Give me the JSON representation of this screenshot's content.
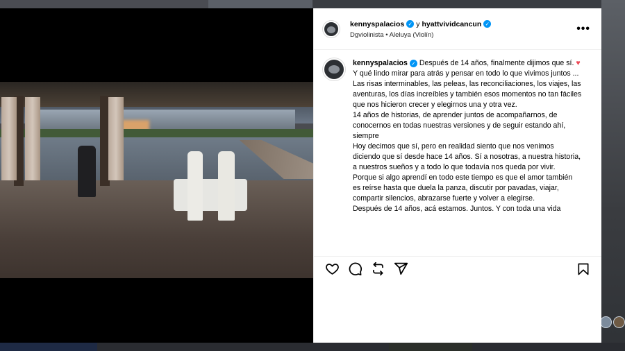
{
  "post": {
    "author": "kennyspalacios",
    "connector": "y",
    "collaborator": "hyattvividcancun",
    "audio_line": "Dgviolinista • Aleluya (Violín)",
    "more_label": "•••"
  },
  "caption": {
    "author": "kennyspalacios",
    "first_line": "Después de 14 años, finalmente dijimos que sí.",
    "heart": "♥",
    "paragraphs": [
      "Y qué lindo mirar para atrás y pensar en todo lo que vivimos juntos ... Las risas interminables, las peleas, las reconciliaciones, los viajes, las aventuras, los días increíbles y también esos momentos no tan fáciles que nos hicieron crecer y elegirnos una y otra vez.",
      "14 años de historias, de aprender juntos de acompañarnos, de conocernos en todas nuestras versiones y de seguir estando ahí, siempre",
      "Hoy decimos que sí, pero en realidad siento que nos venimos diciendo que sí desde hace 14 años. Sí a nosotras, a nuestra historia, a nuestros sueños y a todo lo que todavía nos queda por vivir.",
      "Porque si algo aprendí en todo este tiempo es que el amor también es reírse hasta que duela la panza, discutir por pavadas, viajar, compartir silencios, abrazarse fuerte y volver a elegirse.",
      "Después de 14 años, acá estamos. Juntos. Y con toda una vida"
    ]
  },
  "icons": {
    "verified": "verified-badge-icon",
    "mute": "speaker-muted-icon",
    "like": "heart-outline-icon",
    "comment": "comment-icon",
    "repost": "repost-icon",
    "share": "send-paper-plane-icon",
    "save": "bookmark-icon"
  },
  "colors": {
    "verified_blue": "#0095f6",
    "heart_red": "#ed4956",
    "media_bg": "#000000",
    "panel_bg": "#ffffff"
  }
}
